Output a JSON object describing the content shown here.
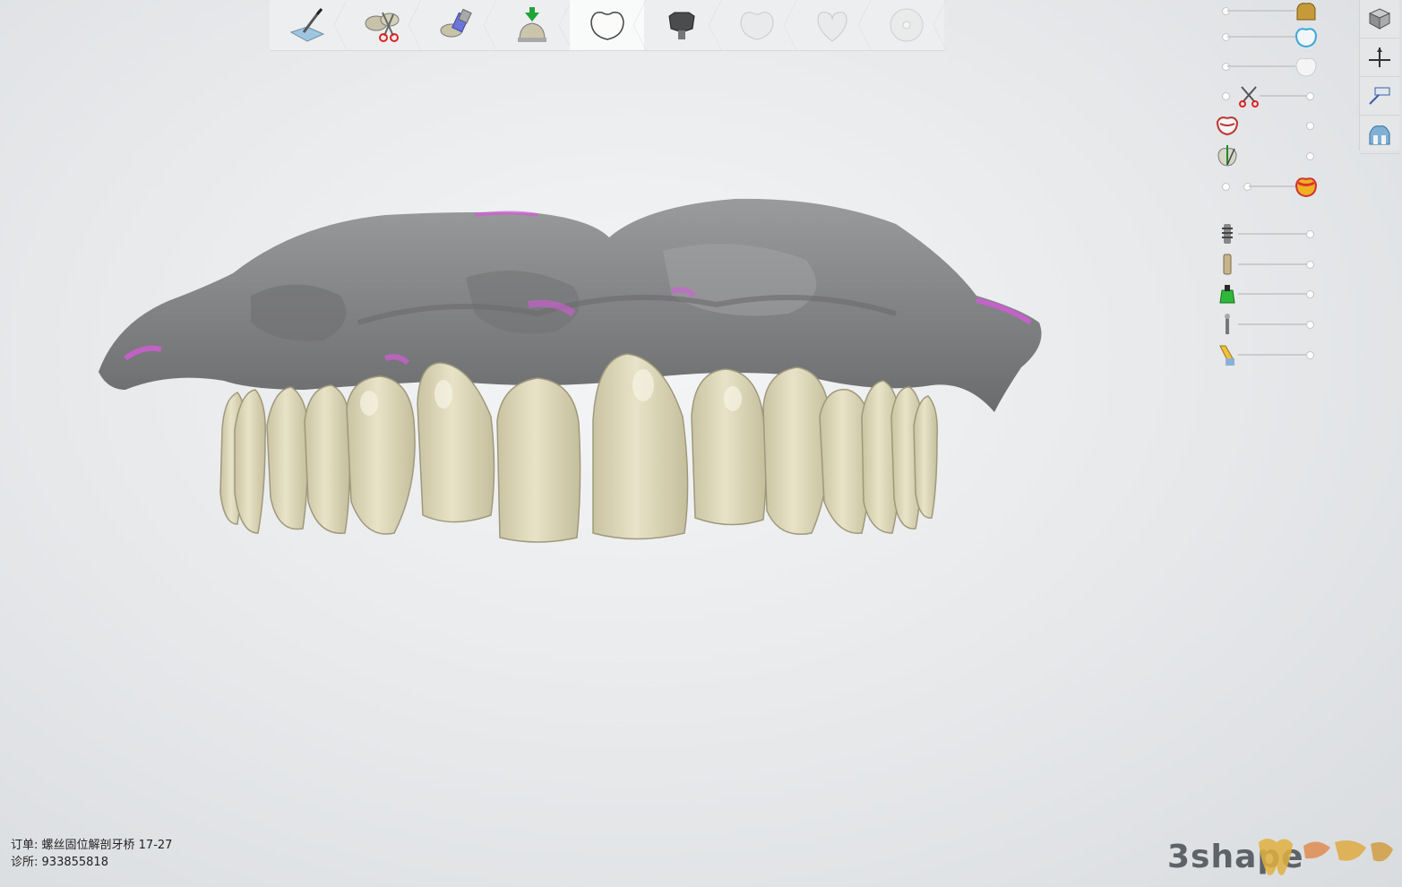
{
  "workflow": {
    "steps": [
      {
        "name": "prepare-scan",
        "icon": "scan-knife-icon",
        "state": "done"
      },
      {
        "name": "segment",
        "icon": "cut-scissors-icon",
        "state": "done"
      },
      {
        "name": "adjust-model",
        "icon": "model-blocks-icon",
        "state": "done"
      },
      {
        "name": "insertion-direction",
        "icon": "insertion-arrow-icon",
        "state": "done"
      },
      {
        "name": "anatomy-design",
        "icon": "crown-icon",
        "state": "active"
      },
      {
        "name": "connector",
        "icon": "abutment-icon",
        "state": "next"
      },
      {
        "name": "sculpt",
        "icon": "crown-outline-icon",
        "state": "disabled"
      },
      {
        "name": "finalize",
        "icon": "heart-tooth-icon",
        "state": "disabled"
      },
      {
        "name": "export",
        "icon": "disc-icon",
        "state": "disabled"
      }
    ]
  },
  "visibility_sliders": [
    {
      "icon": "gold-crown-icon",
      "level": 1.0
    },
    {
      "icon": "blue-crown-icon",
      "level": 1.0
    },
    {
      "icon": "white-crown-icon",
      "level": 1.0
    },
    {
      "icon": "scissors-icon",
      "level": 0.0
    },
    {
      "icon": "antagonist-icon",
      "level": 0.0
    },
    {
      "icon": "direction-icon",
      "level": 0.0
    },
    {
      "icon": "gingiva-crown-icon",
      "level": 1.0
    },
    {
      "icon": "implant-screw-icon",
      "level": 0.0
    },
    {
      "icon": "scanbody-icon",
      "level": 0.0
    },
    {
      "icon": "green-abutment-icon",
      "level": 0.0
    },
    {
      "icon": "pin-icon",
      "level": 0.0
    },
    {
      "icon": "drill-icon",
      "level": 0.0
    }
  ],
  "right_tools": [
    "view-cube-icon",
    "section-plane-icon",
    "measure-icon",
    "gingiva-view-icon"
  ],
  "order": {
    "order_label": "订单:",
    "order_value": "螺丝固位解剖牙桥 17-27",
    "clinic_label": "诊所:",
    "clinic_value": "933855818"
  },
  "brand": "3shape",
  "colors": {
    "tooth": "#ddd8b8",
    "model": "#8a8b8c",
    "highlight": "#d25bd8"
  }
}
